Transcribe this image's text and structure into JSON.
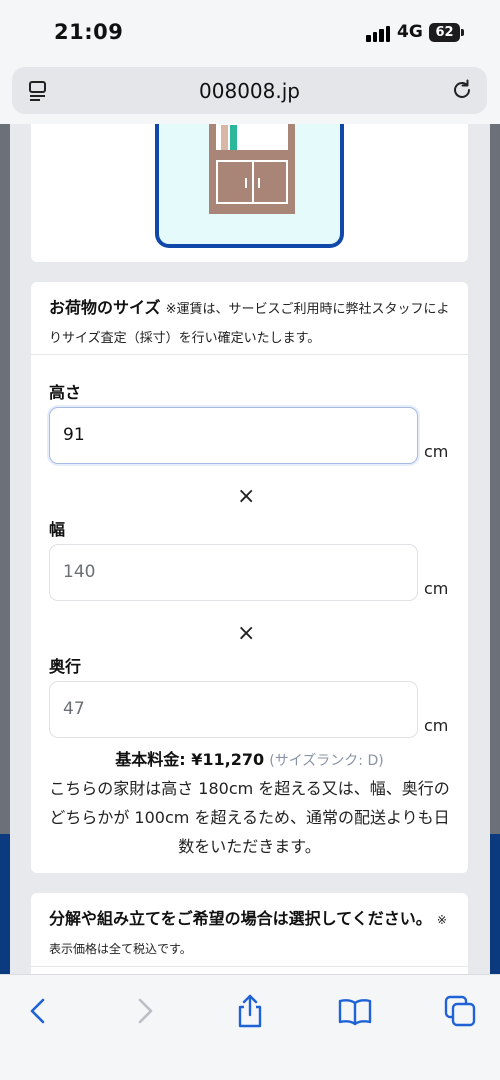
{
  "status_bar": {
    "time": "21:09",
    "network": "4G",
    "battery": "62"
  },
  "browser": {
    "url": "008008.jp"
  },
  "size_section": {
    "title": "お荷物のサイズ",
    "note": "※運賃は、サービスご利用時に弊社スタッフによりサイズ査定（採寸）を行い確定いたします。",
    "height": {
      "label": "高さ",
      "value": "91",
      "unit": "cm"
    },
    "width": {
      "label": "幅",
      "value": "140",
      "unit": "cm"
    },
    "depth": {
      "label": "奥行",
      "value": "47",
      "unit": "cm"
    },
    "multiply": "×",
    "price_label": "基本料金: ¥11,270",
    "rank_label": "(サイズランク: D)",
    "notice": "こちらの家財は高さ 180cm を超える又は、幅、奥行のどちらかが 100cm を超えるため、通常の配送よりも日数をいただきます。"
  },
  "assembly_section": {
    "title": "分解や組み立てをご希望の場合は選択してください。",
    "note": "※表示価格は全て税込です。"
  },
  "colors": {
    "accent": "#0f48a8",
    "navy": "#0b3a7e",
    "cabinet": "#a98577",
    "teal": "#2ab79a"
  },
  "toolbar_icons": [
    "back-icon",
    "forward-icon",
    "share-icon",
    "bookmarks-icon",
    "tabs-icon"
  ]
}
